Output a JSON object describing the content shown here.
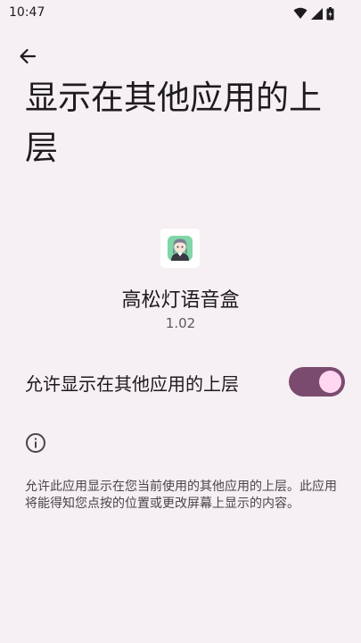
{
  "status_bar": {
    "time": "10:47",
    "icons": [
      "wifi-icon",
      "signal-icon",
      "battery-icon"
    ]
  },
  "header": {
    "back_icon": "arrow-left-icon",
    "title": "显示在其他应用的上层"
  },
  "app": {
    "icon": "anime-character-app-icon",
    "name": "高松灯语音盒",
    "version": "1.02"
  },
  "permission": {
    "label": "允许显示在其他应用的上层",
    "enabled": true
  },
  "info": {
    "icon": "info-icon",
    "description": "允许此应用显示在您当前使用的其他应用的上层。此应用将能得知您点按的位置或更改屏幕上显示的内容。"
  },
  "colors": {
    "background": "#f6eff3",
    "toggle_track": "#7b4b6f",
    "toggle_thumb": "#ffd7f1"
  }
}
